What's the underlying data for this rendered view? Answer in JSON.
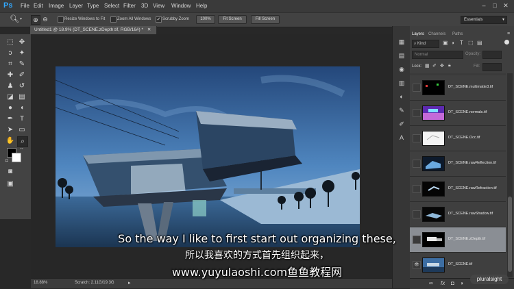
{
  "app": {
    "logo": "Ps",
    "menus": [
      "File",
      "Edit",
      "Image",
      "Layer",
      "Type",
      "Select",
      "Filter",
      "3D",
      "View",
      "Window",
      "Help"
    ]
  },
  "options": {
    "resize_windows": "Resize Windows to Fit",
    "zoom_all": "Zoom All Windows",
    "scrubby": "Scrubby Zoom",
    "btn_100": "100%",
    "btn_fit": "Fit Screen",
    "btn_fill": "Fill Screen",
    "workspace": "Essentials"
  },
  "document": {
    "tab_title": "Untitled1 @ 18.9% (DT_SCENE.zDepth.tif, RGB/16#) *",
    "zoom": "18.88%",
    "status": "Scratch: 2.11G/19.3G"
  },
  "layers_panel": {
    "tabs": [
      "Layers",
      "Channels",
      "Paths"
    ],
    "kind": "Kind",
    "blend": "Normal",
    "opacity_label": "Opacity:",
    "lock_label": "Lock:",
    "fill_label": "Fill:",
    "layers": [
      {
        "name": "DT_SCENE.multimatte3.tif",
        "visible": false,
        "selected": false
      },
      {
        "name": "DT_SCENE.normals.tif",
        "visible": false,
        "selected": false
      },
      {
        "name": "DT_SCENE.Occ.tif",
        "visible": false,
        "selected": false
      },
      {
        "name": "DT_SCENE.rawReflection.tif",
        "visible": false,
        "selected": false
      },
      {
        "name": "DT_SCENE.rawRefraction.tif",
        "visible": false,
        "selected": false
      },
      {
        "name": "DT_SCENE.rawShadow.tif",
        "visible": false,
        "selected": false
      },
      {
        "name": "DT_SCENE.zDepth.tif",
        "visible": false,
        "selected": true
      },
      {
        "name": "DT_SCENE.tif",
        "visible": true,
        "selected": false
      }
    ]
  },
  "subtitles": {
    "english": "So the way I like to first start out organizing these,",
    "chinese": "所以我喜欢的方式首先组织起来，",
    "url": "www.yuyulaoshi.com鱼鱼教程网"
  },
  "watermark": "pluralsight",
  "colors": {
    "accent": "#31a8ff",
    "selected_layer": "#8a8e94",
    "sky": "#3f6fa8"
  }
}
